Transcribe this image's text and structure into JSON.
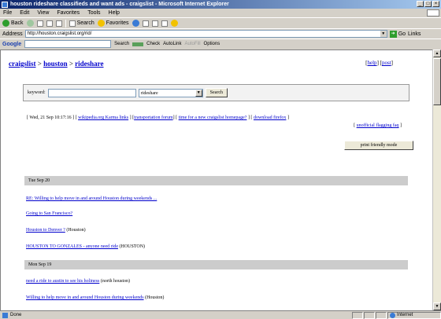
{
  "window": {
    "title": "houston rideshare classifieds and want ads - craigslist - Microsoft Internet Explorer",
    "buttons": [
      "_",
      "□",
      "×"
    ]
  },
  "menu": [
    "File",
    "Edit",
    "View",
    "Favorites",
    "Tools",
    "Help"
  ],
  "toolbar": {
    "back": "Back",
    "search": "Search",
    "favorites": "Favorites"
  },
  "address": {
    "label": "Address",
    "url": "http://houston.craigslist.org/rid/",
    "go": "Go",
    "links": "Links"
  },
  "google": {
    "logo": "Google",
    "search": "Search",
    "pagerank": "PageRank",
    "check": "Check",
    "autolink": "AutoLink",
    "autofill": "AutoFill",
    "options": "Options"
  },
  "page": {
    "crumbs": {
      "site": "craigslist",
      "city": "houston",
      "section": "rideshare",
      "sep": ">"
    },
    "toplinks": {
      "help": "help",
      "post": "post"
    },
    "search": {
      "label": "keyword:",
      "keyword_value": "",
      "category_value": "rideshare",
      "button": "Search"
    },
    "info": {
      "date": "[ Wed, 21 Sep 10:17:16 ]",
      "links": [
        "wikipedia.org Karma links",
        "transportation forum",
        "time for a new craigslist homepage?",
        "download firefox",
        "unofficial flagging faq"
      ]
    },
    "print_button": "print friendly mode",
    "days": [
      {
        "header": "Tue Sep 20",
        "posts": [
          {
            "title": "RE: Willing to help move in and around Houston during weekends ...",
            "loc": ""
          },
          {
            "title": "Going to San Francisco?",
            "loc": ""
          },
          {
            "title": "Houston to Denver ?",
            "loc": "(Houston)"
          },
          {
            "title": "HOUSTON TO GONZALES - anyone need ride",
            "loc": "(HOUSTON)"
          }
        ]
      },
      {
        "header": "Mon Sep 19",
        "posts": [
          {
            "title": "need a ride to austin to see his holiness",
            "loc": "(north houston)"
          },
          {
            "title": "Willing to help move in and around Houston during weekends",
            "loc": "(Houston)"
          }
        ]
      }
    ]
  },
  "status": {
    "left": "Done",
    "zone": "Internet"
  }
}
